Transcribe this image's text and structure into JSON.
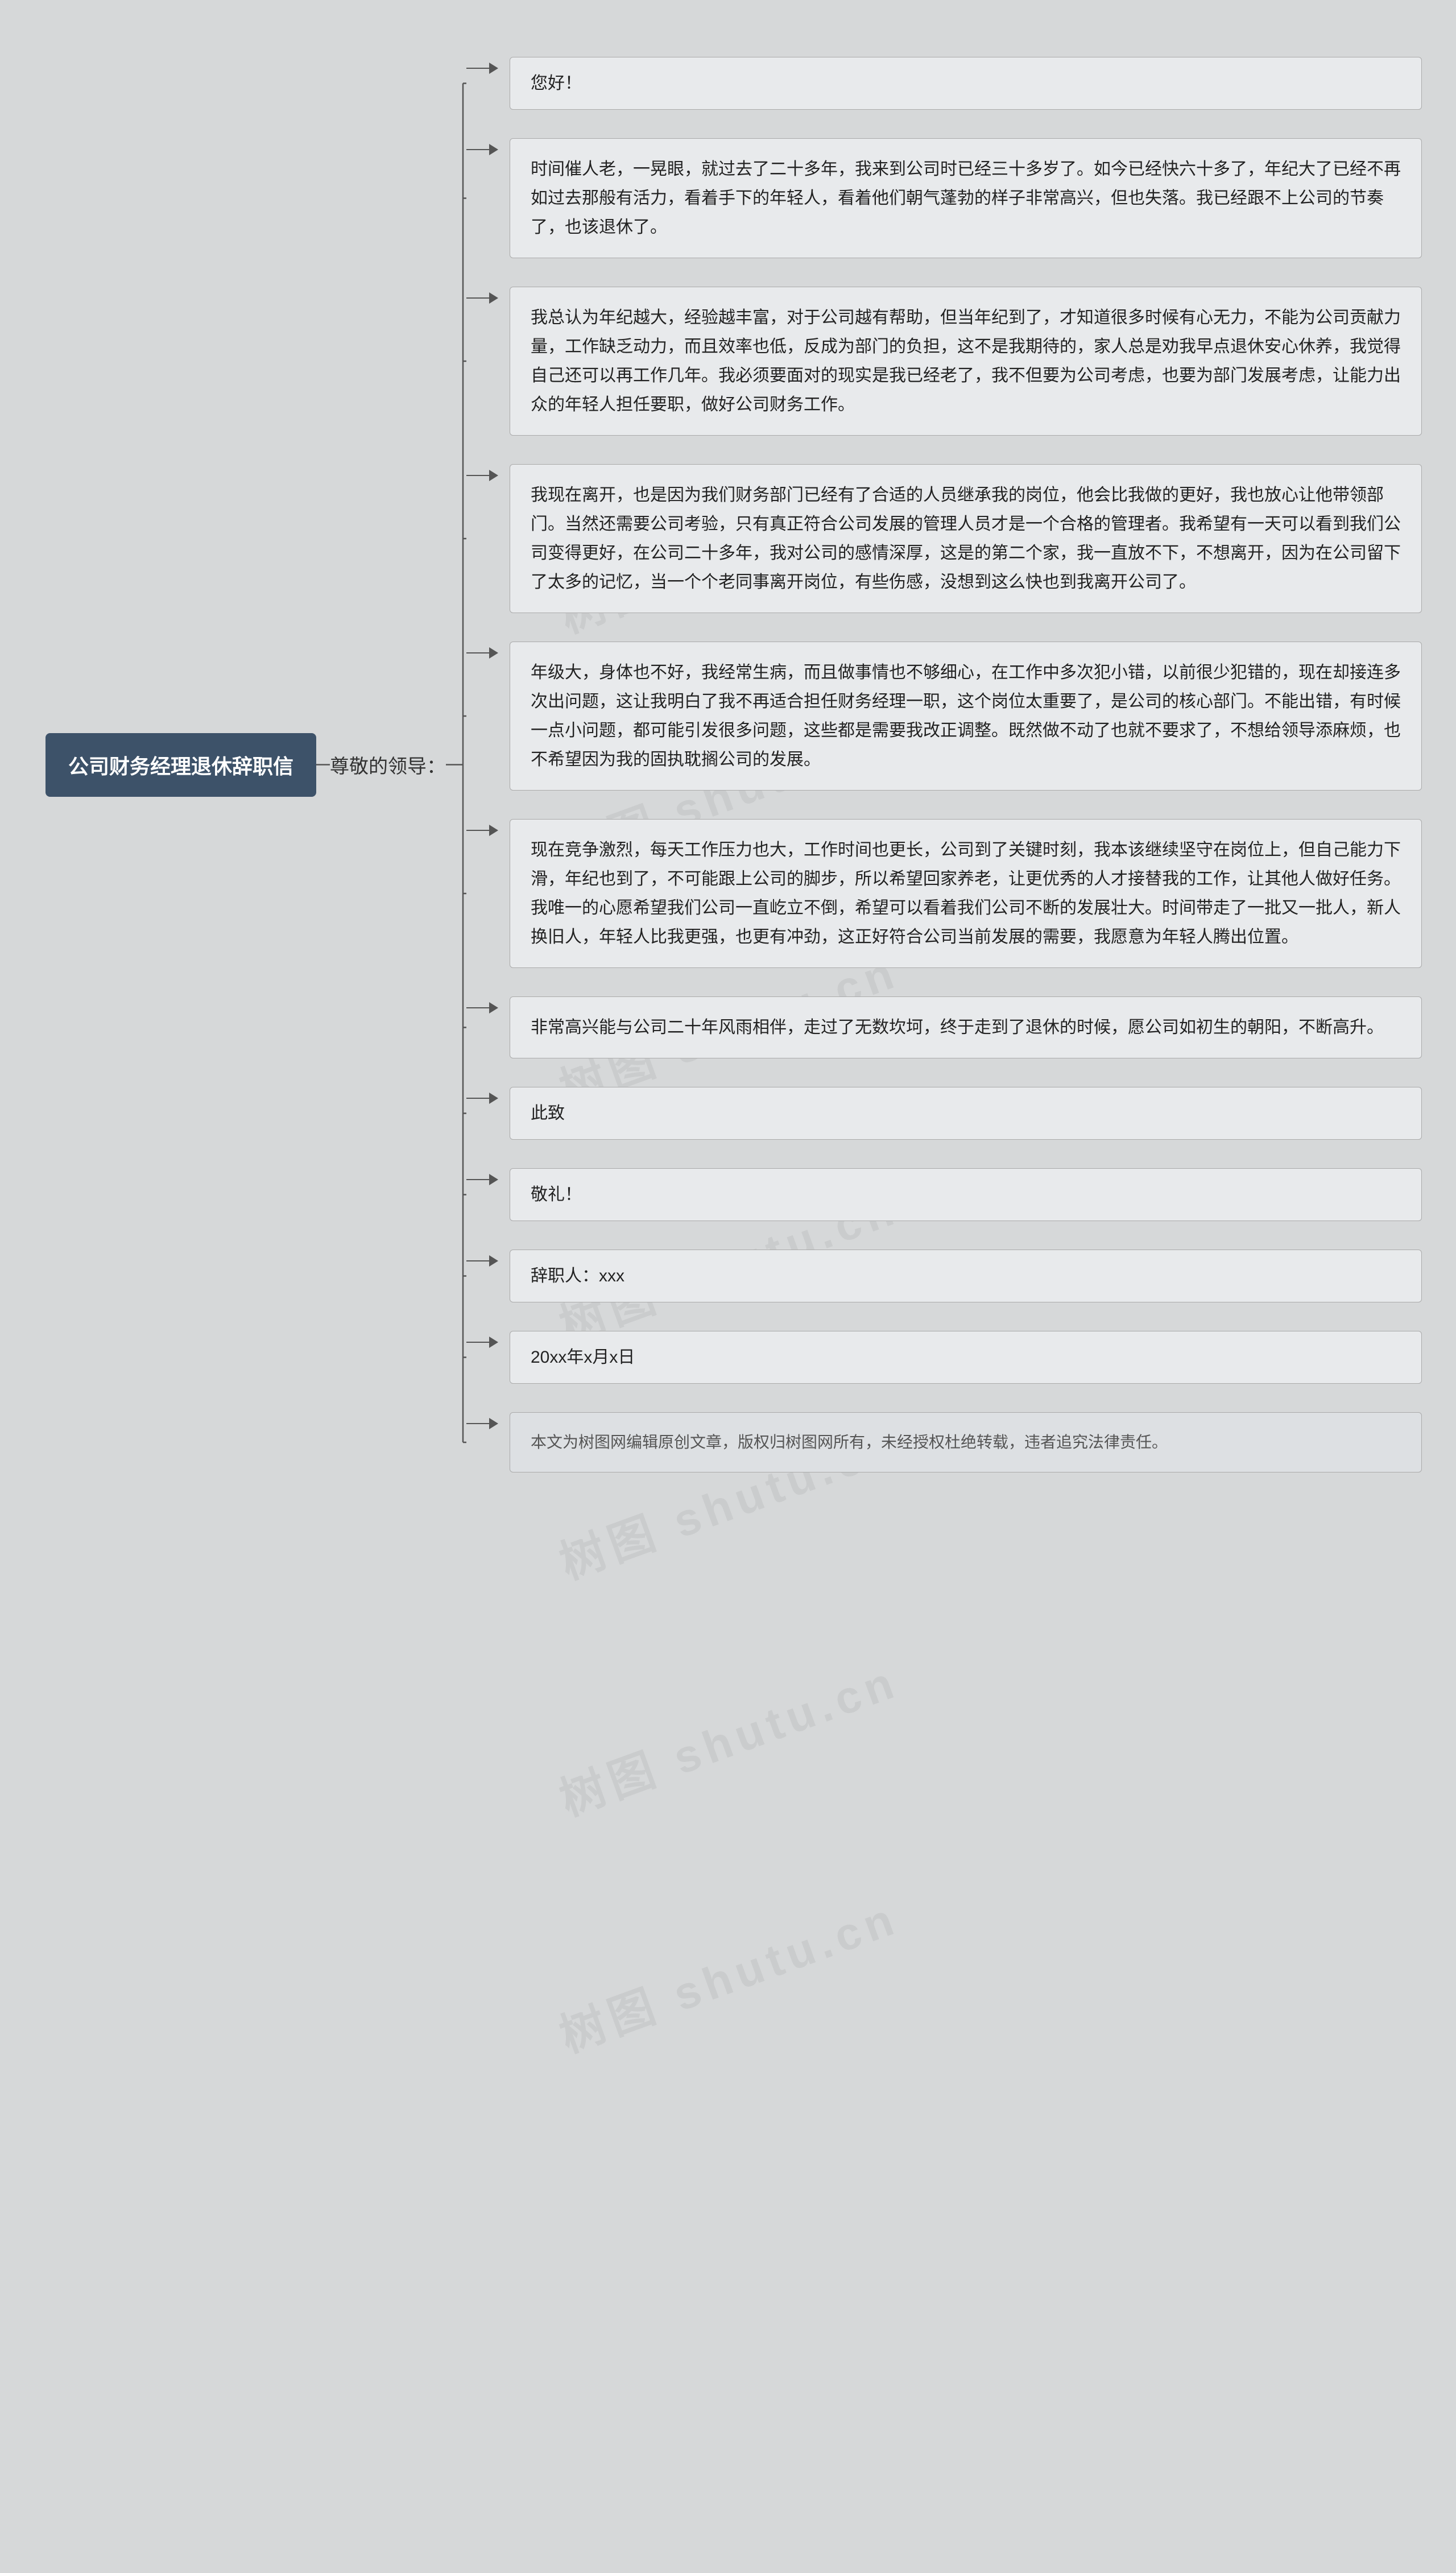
{
  "title": "公司财务经理退休辞职信",
  "connector": "尊敬的领导：",
  "watermark": "树图 shutu.cn",
  "branches": [
    {
      "id": "b1",
      "type": "simple",
      "text": "您好！"
    },
    {
      "id": "b2",
      "type": "block",
      "text": "时间催人老，一晃眼，就过去了二十多年，我来到公司时已经三十多岁了。如今已经快六十多了，年纪大了已经不再如过去那般有活力，看着手下的年轻人，看着他们朝气蓬勃的样子非常高兴，但也失落。我已经跟不上公司的节奏了，也该退休了。"
    },
    {
      "id": "b3",
      "type": "block",
      "text": "我总认为年纪越大，经验越丰富，对于公司越有帮助，但当年纪到了，才知道很多时候有心无力，不能为公司贡献力量，工作缺乏动力，而且效率也低，反成为部门的负担，这不是我期待的，家人总是劝我早点退休安心休养，我觉得自己还可以再工作几年。我必须要面对的现实是我已经老了，我不但要为公司考虑，也要为部门发展考虑，让能力出众的年轻人担任要职，做好公司财务工作。"
    },
    {
      "id": "b4",
      "type": "block",
      "text": "我现在离开，也是因为我们财务部门已经有了合适的人员继承我的岗位，他会比我做的更好，我也放心让他带领部门。当然还需要公司考验，只有真正符合公司发展的管理人员才是一个合格的管理者。我希望有一天可以看到我们公司变得更好，在公司二十多年，我对公司的感情深厚，这是的第二个家，我一直放不下，不想离开，因为在公司留下了太多的记忆，当一个个老同事离开岗位，有些伤感，没想到这么快也到我离开公司了。"
    },
    {
      "id": "b5",
      "type": "block",
      "text": "年级大，身体也不好，我经常生病，而且做事情也不够细心，在工作中多次犯小错，以前很少犯错的，现在却接连多次出问题，这让我明白了我不再适合担任财务经理一职，这个岗位太重要了，是公司的核心部门。不能出错，有时候一点小问题，都可能引发很多问题，这些都是需要我改正调整。既然做不动了也就不要求了，不想给领导添麻烦，也不希望因为我的固执耽搁公司的发展。"
    },
    {
      "id": "b6",
      "type": "block",
      "text": "现在竞争激烈，每天工作压力也大，工作时间也更长，公司到了关键时刻，我本该继续坚守在岗位上，但自己能力下滑，年纪也到了，不可能跟上公司的脚步，所以希望回家养老，让更优秀的人才接替我的工作，让其他人做好任务。我唯一的心愿希望我们公司一直屹立不倒，希望可以看着我们公司不断的发展壮大。时间带走了一批又一批人，新人换旧人，年轻人比我更强，也更有冲劲，这正好符合公司当前发展的需要，我愿意为年轻人腾出位置。"
    },
    {
      "id": "b7",
      "type": "block",
      "text": "非常高兴能与公司二十年风雨相伴，走过了无数坎坷，终于走到了退休的时候，愿公司如初生的朝阳，不断高升。"
    },
    {
      "id": "b8",
      "type": "simple",
      "text": "此致"
    },
    {
      "id": "b9",
      "type": "simple",
      "text": "敬礼！"
    },
    {
      "id": "b10",
      "type": "simple",
      "text": "辞职人：xxx"
    },
    {
      "id": "b11",
      "type": "simple",
      "text": "20xx年x月x日"
    },
    {
      "id": "b12",
      "type": "copyright",
      "text": "本文为树图网编辑原创文章，版权归树图网所有，未经授权杜绝转载，违者追究法律责任。"
    }
  ]
}
